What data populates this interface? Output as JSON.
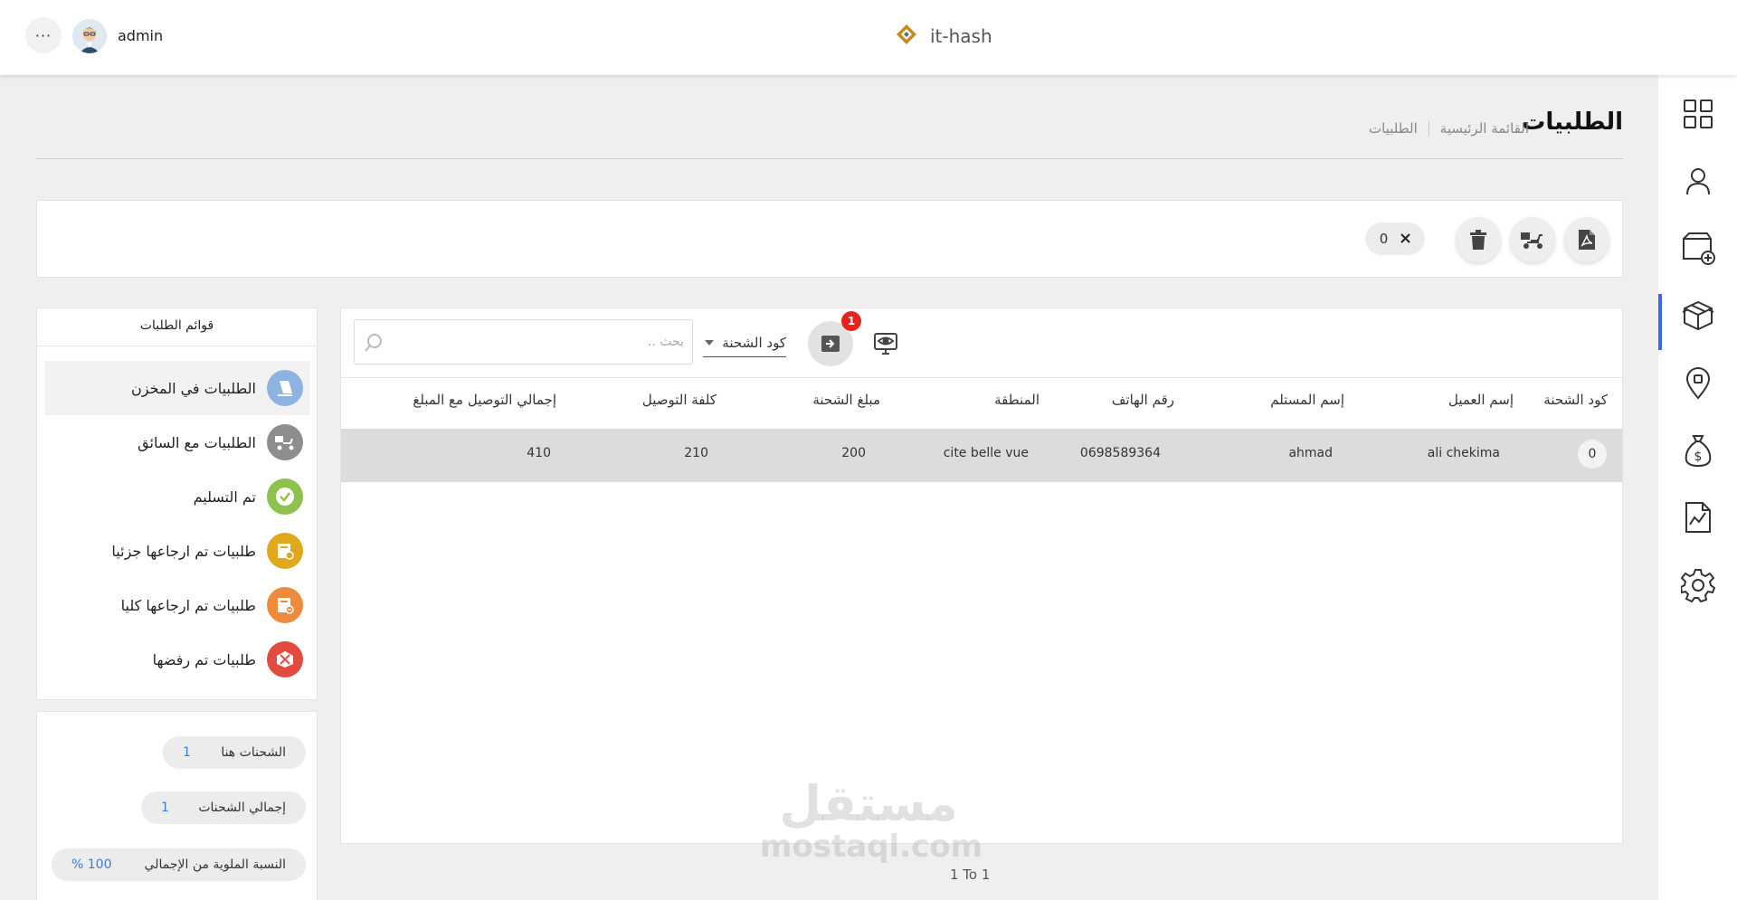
{
  "topbar": {
    "more_label": "···",
    "username": "admin",
    "brand": "it-hash"
  },
  "header": {
    "title": "الطلبيات",
    "breadcrumb": [
      "القائمة الرئيسية",
      "الطلبيات"
    ]
  },
  "actions": {
    "selected_count": "0"
  },
  "orders": {
    "search_placeholder": "بحث ..",
    "filter_field": "كود الشحنة",
    "badge": "1",
    "columns": [
      "كود الشحنة",
      "إسم العميل",
      "إسم المستلم",
      "رقم الهاتف",
      "المنطقة",
      "مبلغ الشحنة",
      "كلفة التوصيل",
      "إجمالي التوصيل مع المبلغ"
    ],
    "rows": [
      {
        "code": "0",
        "client": "ali chekima",
        "recipient": "ahmad",
        "phone": "0698589364",
        "region": "cite belle vue",
        "amount": "200",
        "delivery_cost": "210",
        "total": "410"
      }
    ],
    "pager": "1 To 1"
  },
  "lists": {
    "title": "قوائم الطلبات",
    "items": [
      {
        "label": "الطلبيات في المخزن",
        "icon": "warehouse-icon",
        "color": "#8fb3e0"
      },
      {
        "label": "الطلبيات مع السائق",
        "icon": "driver-icon",
        "color": "#8d8d8d"
      },
      {
        "label": "تم التسليم",
        "icon": "delivered-icon",
        "color": "#8dc24d"
      },
      {
        "label": "طلبيات تم ارجاعها جزئيا",
        "icon": "partial-return-icon",
        "color": "#e0a81a"
      },
      {
        "label": "طلبيات تم ارجاعها كليا",
        "icon": "full-return-icon",
        "color": "#ee8a3c"
      },
      {
        "label": "طلبيات تم رفضها",
        "icon": "rejected-icon",
        "color": "#e24b3f"
      }
    ]
  },
  "stats": [
    {
      "label": "الشحنات هنا",
      "value": "1"
    },
    {
      "label": "إجمالي الشحنات",
      "value": "1"
    },
    {
      "label": "النسبة الملوية من الإجمالي",
      "value": "100 %"
    }
  ],
  "watermark": {
    "ar": "مستقل",
    "en": "mostaql.com"
  },
  "colors": {
    "accent": "#3c69e7",
    "badge": "#e8221d",
    "row_selected": "#dcdcdc",
    "brand_mark": "#c58a1e"
  }
}
